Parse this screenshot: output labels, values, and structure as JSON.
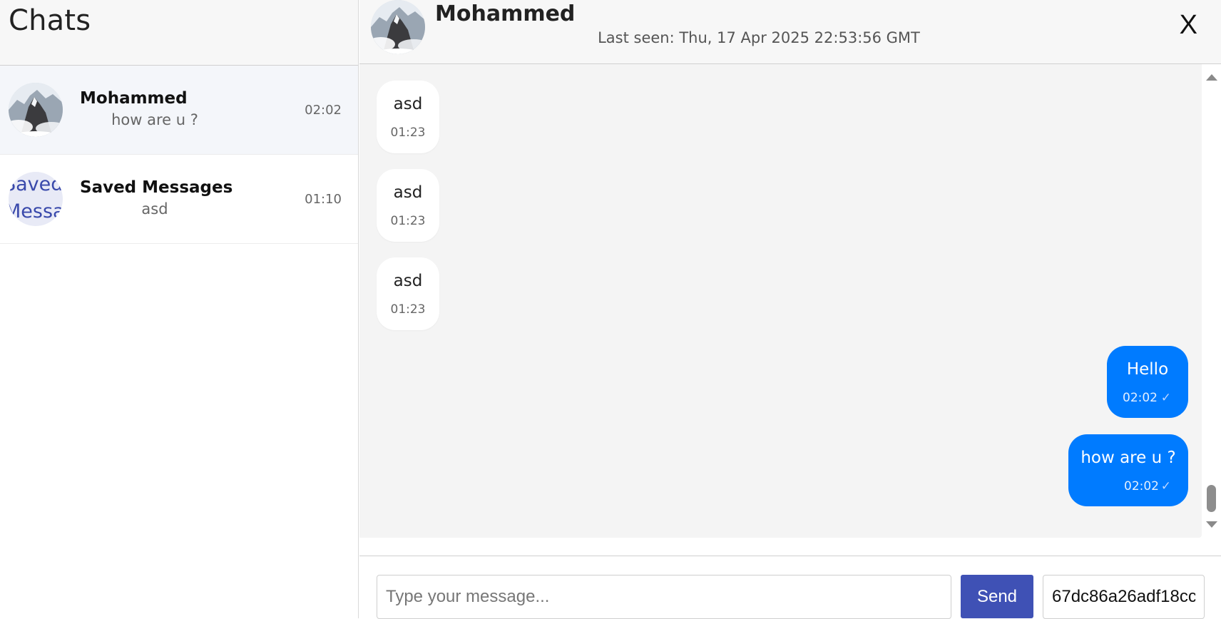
{
  "sidebar": {
    "title": "Chats",
    "chats": [
      {
        "name": "Mohammed",
        "preview": "how are u ?",
        "time": "02:02",
        "active": true
      },
      {
        "name": "Saved Messages",
        "preview": "asd",
        "time": "01:10",
        "avatar_text_line1": "Saved",
        "avatar_text_line2": "Messages"
      }
    ]
  },
  "chat": {
    "contact_name": "Mohammed",
    "last_seen": "Last seen: Thu, 17 Apr 2025 22:53:56 GMT",
    "close_label": "X",
    "messages": [
      {
        "direction": "in",
        "text": "asd",
        "time": "01:23"
      },
      {
        "direction": "in",
        "text": "asd",
        "time": "01:23"
      },
      {
        "direction": "in",
        "text": "asd",
        "time": "01:23"
      },
      {
        "direction": "out",
        "text": "Hello",
        "time": "02:02",
        "status": "✓"
      },
      {
        "direction": "out",
        "text": "how are u ?",
        "time": "02:02",
        "status": "✓"
      }
    ]
  },
  "composer": {
    "placeholder": "Type your message...",
    "send_label": "Send",
    "id_value": "67dc86a26adf18cc"
  },
  "colors": {
    "outgoing_bubble": "#007bff",
    "send_button": "#3f51b5"
  }
}
